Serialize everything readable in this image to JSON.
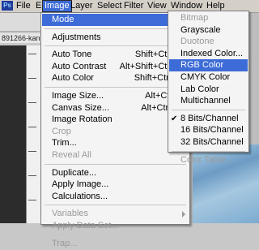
{
  "menubar": {
    "logo": "Ps",
    "items": [
      "File",
      "Edit",
      "Image",
      "Layer",
      "Select",
      "Filter",
      "View",
      "Window",
      "Help"
    ]
  },
  "document": {
    "tab_label": "891266-kang"
  },
  "colors": {
    "highlight": "#3d6bd7",
    "menu_bg": "#f4f4f4",
    "disabled": "#9a9a9a"
  },
  "image_menu": {
    "items": [
      {
        "label": "Mode",
        "submenu": true,
        "state": "highlight"
      },
      {
        "separator": true
      },
      {
        "label": "Adjustments",
        "submenu": true
      },
      {
        "separator": true
      },
      {
        "label": "Auto Tone",
        "shortcut": "Shift+Ctrl+L"
      },
      {
        "label": "Auto Contrast",
        "shortcut": "Alt+Shift+Ctrl+L"
      },
      {
        "label": "Auto Color",
        "shortcut": "Shift+Ctrl+B"
      },
      {
        "separator": true
      },
      {
        "label": "Image Size...",
        "shortcut": "Alt+Ctrl+I"
      },
      {
        "label": "Canvas Size...",
        "shortcut": "Alt+Ctrl+C"
      },
      {
        "label": "Image Rotation",
        "submenu": true
      },
      {
        "label": "Crop",
        "state": "disabled"
      },
      {
        "label": "Trim..."
      },
      {
        "label": "Reveal All",
        "state": "disabled"
      },
      {
        "separator": true
      },
      {
        "label": "Duplicate..."
      },
      {
        "label": "Apply Image..."
      },
      {
        "label": "Calculations..."
      },
      {
        "separator": true
      },
      {
        "label": "Variables",
        "submenu": true,
        "state": "disabled"
      },
      {
        "label": "Apply Data Set...",
        "state": "disabled"
      },
      {
        "separator": true
      },
      {
        "label": "Trap...",
        "state": "disabled"
      }
    ]
  },
  "mode_menu": {
    "items": [
      {
        "label": "Bitmap",
        "state": "disabled"
      },
      {
        "label": "Grayscale"
      },
      {
        "label": "Duotone",
        "state": "disabled"
      },
      {
        "label": "Indexed Color..."
      },
      {
        "label": "RGB Color",
        "state": "highlight"
      },
      {
        "label": "CMYK Color"
      },
      {
        "label": "Lab Color"
      },
      {
        "label": "Multichannel"
      },
      {
        "separator": true
      },
      {
        "label": "8 Bits/Channel",
        "checked": true
      },
      {
        "label": "16 Bits/Channel"
      },
      {
        "label": "32 Bits/Channel"
      },
      {
        "separator": true
      },
      {
        "label": "Color Table...",
        "state": "disabled"
      }
    ]
  }
}
